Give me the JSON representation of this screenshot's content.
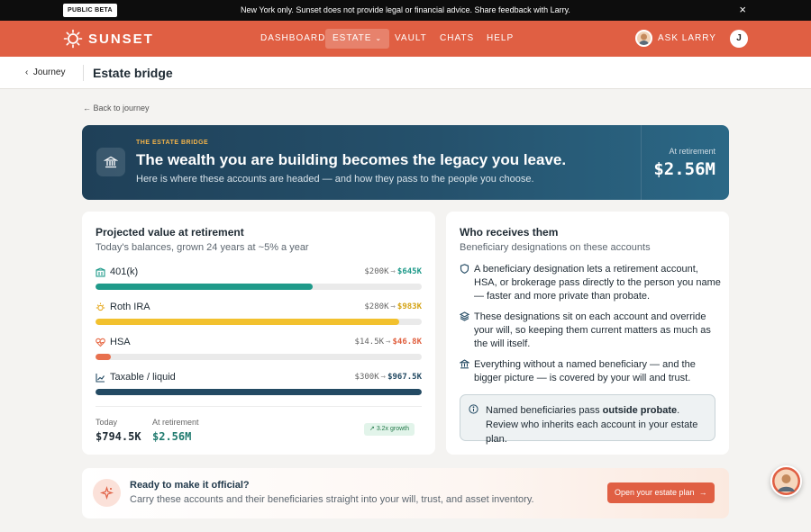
{
  "banner": {
    "badge": "PUBLIC BETA",
    "message": "New York only. Sunset does not provide legal or financial advice. Share feedback with Larry.",
    "close_icon": "×"
  },
  "nav": {
    "brand": "SUNSET",
    "items": [
      {
        "label": "DASHBOARD"
      },
      {
        "label": "ESTATE",
        "active": true
      },
      {
        "label": "VAULT"
      },
      {
        "label": "CHATS"
      },
      {
        "label": "HELP"
      }
    ],
    "ask_label": "ASK LARRY",
    "user_initial": "J"
  },
  "breadcrumb": {
    "back_label": "Journey",
    "title": "Estate bridge"
  },
  "back_link": "Back to journey",
  "hero": {
    "eyebrow": "THE ESTATE BRIDGE",
    "title": "The wealth you are building becomes the legacy you leave.",
    "subtitle": "Here is where these accounts are headed — and how they pass to the people you choose.",
    "at_label": "At retirement",
    "value": "$2.56M"
  },
  "projection": {
    "title": "Projected value at retirement",
    "subtitle": "Today's balances, grown 24 years at ~5% a year",
    "accounts": [
      {
        "name": "401(k)",
        "from": "$200K",
        "to": "$645K",
        "color": "#1f9a8a",
        "fraction": 0.667,
        "icon": "building-icon"
      },
      {
        "name": "Roth IRA",
        "from": "$280K",
        "to": "$983K",
        "color": "#f2c12e",
        "fraction": 0.93,
        "icon": "sun-icon"
      },
      {
        "name": "HSA",
        "from": "$14.5K",
        "to": "$46.8K",
        "color": "#e8704e",
        "fraction": 0.048,
        "icon": "heart-icon"
      },
      {
        "name": "Taxable / liquid",
        "from": "$300K",
        "to": "$967.5K",
        "color": "#234a63",
        "fraction": 1.0,
        "icon": "chart-icon"
      }
    ],
    "arrow": "→",
    "today_label": "Today",
    "today_value": "$794.5K",
    "retire_label": "At retirement",
    "retire_value": "$2.56M",
    "growth_badge": "3.2x growth"
  },
  "beneficiaries": {
    "title": "Who receives them",
    "subtitle": "Beneficiary designations on these accounts",
    "points": [
      "A beneficiary designation lets a retirement account, HSA, or brokerage pass directly to the person you name — faster and more private than probate.",
      "These designations sit on each account and override your will, so keeping them current matters as much as the will itself.",
      "Everything without a named beneficiary — and the bigger picture — is covered by your will and trust."
    ],
    "note_pre": "Named beneficiaries pass ",
    "note_bold": "outside probate",
    "note_post": ". Review who inherits each account in your estate plan."
  },
  "cta": {
    "title": "Ready to make it official?",
    "subtitle": "Carry these accounts and their beneficiaries straight into your will, trust, and asset inventory.",
    "button": "Open your estate plan",
    "button_arrow": "→"
  },
  "colors": {
    "brand": "#e05f43",
    "hero_bg": "#1f4058",
    "accent_gold": "#f2b34a"
  }
}
